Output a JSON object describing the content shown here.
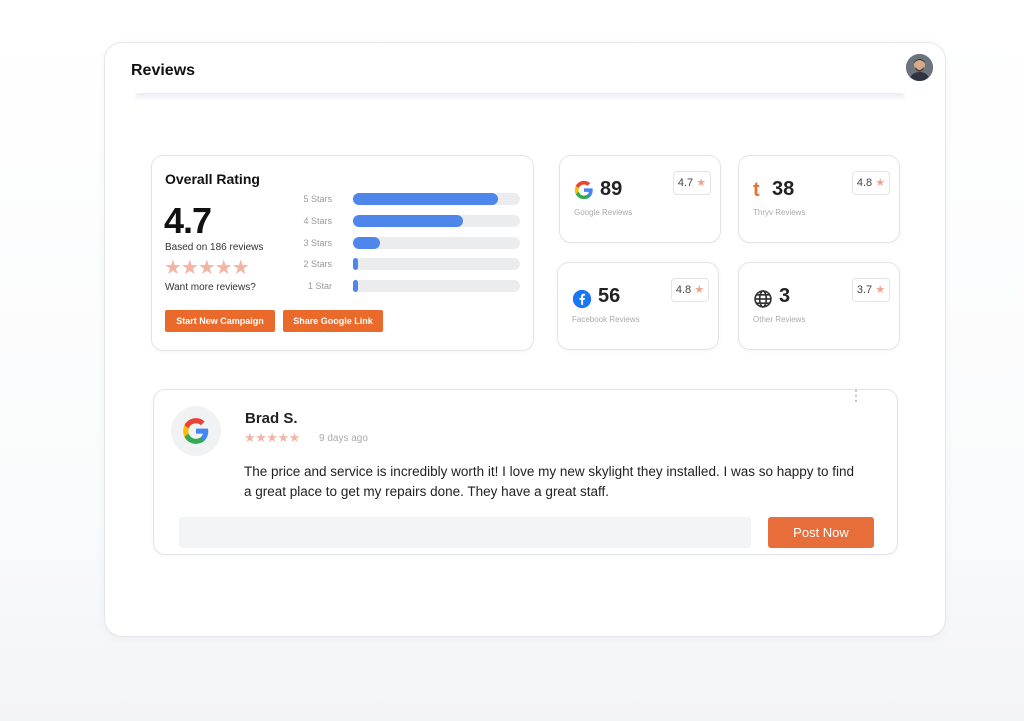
{
  "header": {
    "title": "Reviews"
  },
  "overall": {
    "title": "Overall Rating",
    "rating": "4.7",
    "based_on": "Based on 186 reviews",
    "stars": "★★★★★",
    "want_more": "Want more reviews?",
    "bars": [
      {
        "label": "5 Stars",
        "fraction": 0.87
      },
      {
        "label": "4 Stars",
        "fraction": 0.66
      },
      {
        "label": "3 Stars",
        "fraction": 0.16
      },
      {
        "label": "2 Stars",
        "fraction": 0.03
      },
      {
        "label": "1 Star",
        "fraction": 0.03
      }
    ],
    "buttons": {
      "campaign": "Start New Campaign",
      "share": "Share Google Link"
    }
  },
  "sources": [
    {
      "icon": "google-icon",
      "count": "89",
      "label": "Google Reviews",
      "rating": "4.7"
    },
    {
      "icon": "thryv-icon",
      "count": "38",
      "label": "Thryv Reviews",
      "rating": "4.8"
    },
    {
      "icon": "facebook-icon",
      "count": "56",
      "label": "Facebook Reviews",
      "rating": "4.8"
    },
    {
      "icon": "globe-icon",
      "count": "3",
      "label": "Other Reviews",
      "rating": "3.7"
    }
  ],
  "star_glyph": "★",
  "thryv_letter": "t",
  "review": {
    "name": "Brad S.",
    "stars": "★★★★★",
    "time": "9 days ago",
    "text": "The price and service is incredibly worth it! I love my new skylight they installed. I was so happy to find a great place to get my repairs done. They have a great staff.",
    "menu": "⋮",
    "reply_placeholder": "",
    "post_label": "Post Now"
  },
  "colors": {
    "accent": "#ea6a2c",
    "bar": "#4f86ec",
    "star": "#f3b4a6"
  }
}
